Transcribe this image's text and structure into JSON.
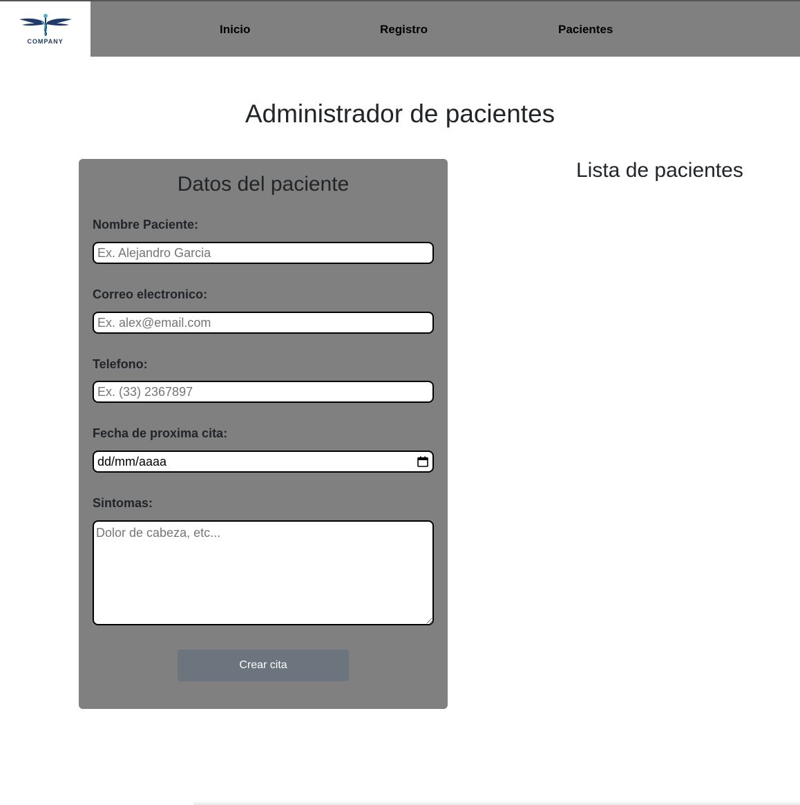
{
  "header": {
    "logo_text": "COMPANY",
    "nav": {
      "inicio": "Inicio",
      "registro": "Registro",
      "pacientes": "Pacientes"
    }
  },
  "main": {
    "title": "Administrador de pacientes",
    "list_title": "Lista de pacientes"
  },
  "form": {
    "title": "Datos del paciente",
    "nombre_label": "Nombre Paciente:",
    "nombre_placeholder": "Ex. Alejandro Garcia",
    "correo_label": "Correo electronico:",
    "correo_placeholder": "Ex. alex@email.com",
    "telefono_label": "Telefono:",
    "telefono_placeholder": "Ex. (33) 2367897",
    "fecha_label": "Fecha de proxima cita:",
    "fecha_value": "dd/mm/aaaa",
    "sintomas_label": "Sintomas:",
    "sintomas_placeholder": "Dolor de cabeza, etc...",
    "submit_label": "Crear cita"
  },
  "colors": {
    "header_bg": "#808080",
    "card_bg": "#808080",
    "button_bg": "#6c757d",
    "logo_blue": "#1f3a6b",
    "logo_teal": "#4fb3bf"
  },
  "icons": {
    "logo": "caduceus-wings-icon",
    "calendar": "calendar-icon"
  }
}
